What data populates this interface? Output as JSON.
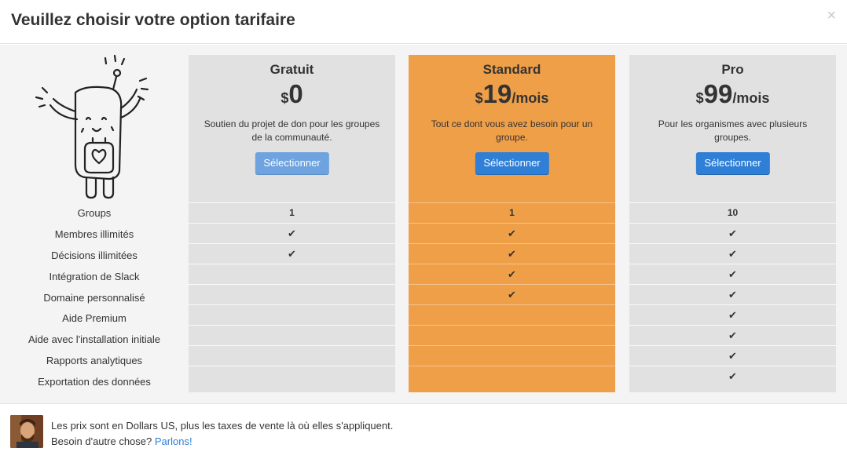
{
  "modal": {
    "title": "Veuillez choisir votre option tarifaire",
    "close_label": "×"
  },
  "features": [
    "Groups",
    "Membres illimités",
    "Décisions illimitées",
    "Intégration de Slack",
    "Domaine personnalisé",
    "Aide Premium",
    "Aide avec l'installation initiale",
    "Rapports analytiques",
    "Exportation des données"
  ],
  "plans": [
    {
      "name": "Gratuit",
      "currency": "$",
      "amount": "0",
      "period": "",
      "description": "Soutien du projet de don pour les groupes de la communauté.",
      "button": "Sélectionner",
      "featured": false,
      "values": [
        "1",
        "✔",
        "✔",
        "",
        "",
        "",
        "",
        "",
        ""
      ]
    },
    {
      "name": "Standard",
      "currency": "$",
      "amount": "19",
      "period": "/mois",
      "description": "Tout ce dont vous avez besoin pour un groupe.",
      "button": "Sélectionner",
      "featured": true,
      "values": [
        "1",
        "✔",
        "✔",
        "✔",
        "✔",
        "",
        "",
        "",
        ""
      ]
    },
    {
      "name": "Pro",
      "currency": "$",
      "amount": "99",
      "period": "/mois",
      "description": "Pour les organismes avec plusieurs groupes.",
      "button": "Sélectionner",
      "featured": false,
      "values": [
        "10",
        "✔",
        "✔",
        "✔",
        "✔",
        "✔",
        "✔",
        "✔",
        "✔"
      ]
    }
  ],
  "footer": {
    "line1": "Les prix sont en Dollars US, plus les taxes de vente là où elles s'appliquent.",
    "line2": "Besoin d'autre chose?",
    "link": "Parlons!"
  },
  "colors": {
    "featured": "#ef9f48",
    "column": "#e1e1e1",
    "button": "#2f7fd6",
    "link": "#2f7fd6"
  }
}
